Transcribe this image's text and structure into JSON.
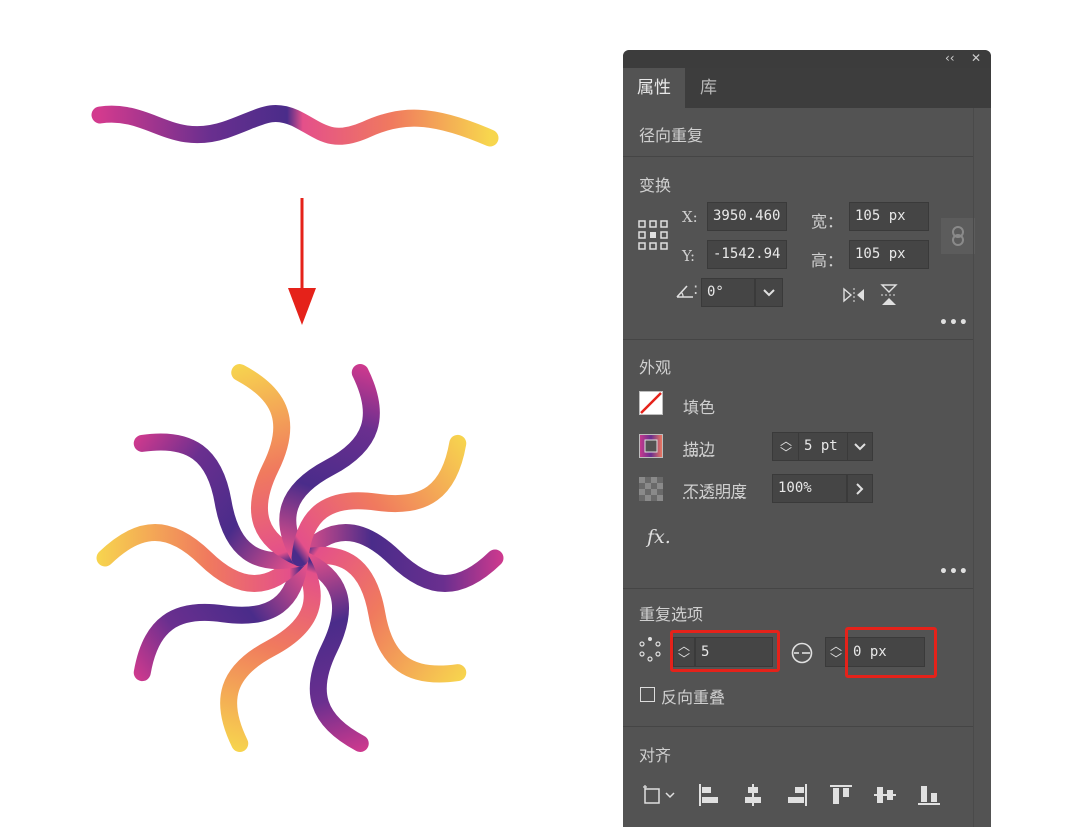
{
  "window": {
    "collapse_icon": "double-chevron-left-icon",
    "close_icon": "close-icon"
  },
  "tabs": [
    {
      "label": "属性",
      "active": true
    },
    {
      "label": "库",
      "active": false
    }
  ],
  "selection_type": "径向重复",
  "transform": {
    "title": "变换",
    "x_label": "X:",
    "x_value": "3950.460",
    "y_label": "Y:",
    "y_value": "-1542.94",
    "width_label": "宽：",
    "width_value": "105 px",
    "height_label": "高：",
    "height_value": "105 px",
    "angle_value": "0°",
    "more": "•••"
  },
  "appearance": {
    "title": "外观",
    "fill_label": "填色",
    "stroke_label": "描边",
    "stroke_value": "5 pt",
    "opacity_label": "不透明度",
    "opacity_value": "100%",
    "fx_label": "fx.",
    "more": "•••"
  },
  "repeat_options": {
    "title": "重复选项",
    "instances_value": "5",
    "radius_value": "0 px",
    "reverse_overlap_label": "反向重叠",
    "reverse_overlap_checked": false
  },
  "align": {
    "title": "对齐"
  },
  "colors": {
    "panel_bg": "#535353",
    "highlight": "#e5221a",
    "arrow": "#e5221a",
    "gradient": [
      "#d23a8e",
      "#6a2f8f",
      "#4a2c8a",
      "#e4508a",
      "#f07a5e",
      "#f7d64e"
    ]
  }
}
